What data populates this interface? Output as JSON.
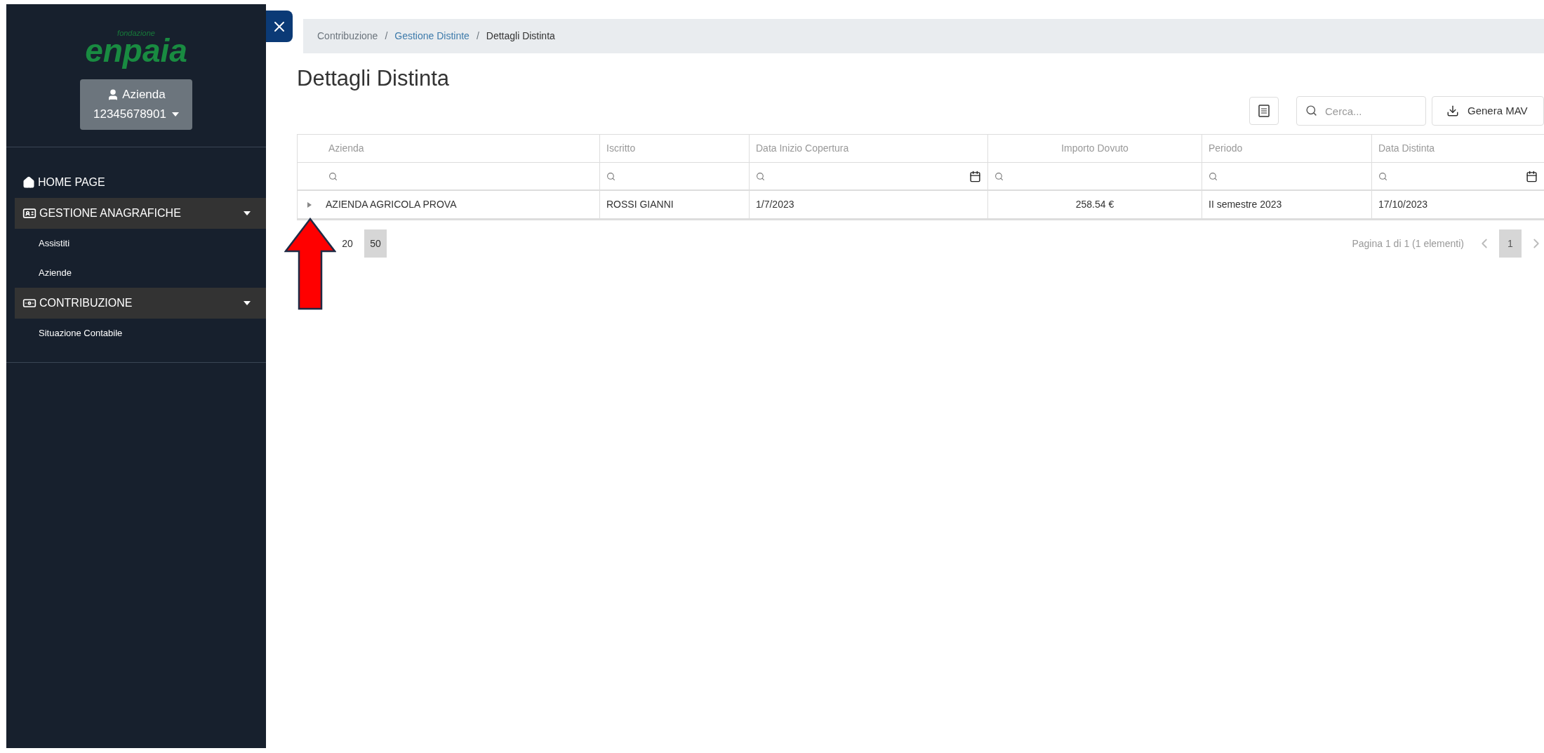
{
  "sidebar": {
    "logo": {
      "small": "fondazione",
      "name": "enpaia"
    },
    "account": {
      "role": "Azienda",
      "code": "12345678901"
    },
    "items": [
      {
        "kind": "link",
        "label": "HOME PAGE"
      },
      {
        "kind": "group",
        "label": "GESTIONE ANAGRAFICHE",
        "expanded": true,
        "children": [
          {
            "label": "Assistiti"
          },
          {
            "label": "Aziende"
          }
        ]
      },
      {
        "kind": "group",
        "label": "CONTRIBUZIONE",
        "expanded": true,
        "children": [
          {
            "label": "Situazione Contabile"
          }
        ]
      }
    ]
  },
  "breadcrumb": [
    {
      "kind": "text",
      "label": "Contribuzione"
    },
    {
      "kind": "separator",
      "label": "/"
    },
    {
      "kind": "link",
      "label": "Gestione Distinte"
    },
    {
      "kind": "separator",
      "label": "/"
    },
    {
      "kind": "current",
      "label": "Dettagli Distinta"
    }
  ],
  "title": "Dettagli Distinta",
  "toolbar": {
    "search_placeholder": "Cerca...",
    "button": "Genera MAV"
  },
  "table": {
    "columns": [
      {
        "kind": "text",
        "label": "Azienda"
      },
      {
        "kind": "text",
        "label": "Iscritto"
      },
      {
        "kind": "date",
        "label": "Data Inizio Copertura"
      },
      {
        "kind": "amount",
        "label": "Importo Dovuto"
      },
      {
        "kind": "text",
        "label": "Periodo"
      },
      {
        "kind": "date",
        "label": "Data Distinta"
      }
    ],
    "rows": [
      {
        "expanded": false,
        "cells": [
          "AZIENDA AGRICOLA PROVA",
          "ROSSI GIANNI",
          "1/7/2023",
          "258.54 €",
          "II semestre 2023",
          "17/10/2023"
        ]
      }
    ]
  },
  "pager": {
    "page_sizes": [
      {
        "label": "20",
        "selected": false
      },
      {
        "label": "50",
        "selected": true
      }
    ],
    "info": "Pagina 1 di 1 (1 elementi)",
    "pages": [
      {
        "label": "1",
        "selected": true
      }
    ]
  }
}
